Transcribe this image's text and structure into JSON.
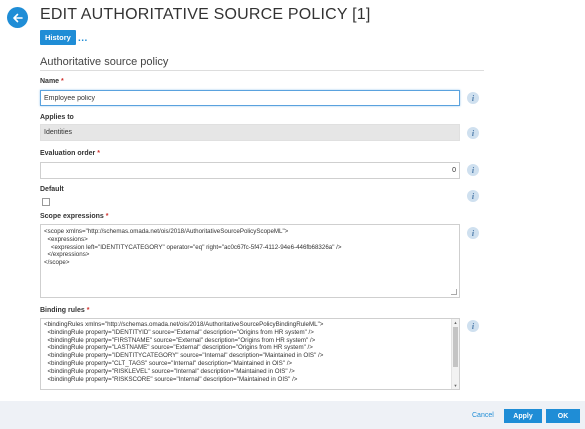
{
  "header": {
    "title": "EDIT AUTHORITATIVE SOURCE POLICY [1]",
    "history_label": "History",
    "more_label": "..."
  },
  "section": {
    "title": "Authoritative source policy"
  },
  "fields": {
    "name": {
      "label": "Name",
      "required": "*",
      "value": "Employee policy"
    },
    "applies_to": {
      "label": "Applies to",
      "value": "Identities"
    },
    "evaluation_order": {
      "label": "Evaluation order",
      "required": "*",
      "value": "0"
    },
    "default": {
      "label": "Default"
    },
    "scope_expressions": {
      "label": "Scope expressions",
      "required": "*",
      "value": "<scope xmlns=\"http://schemas.omada.net/ois/2018/AuthoritativeSourcePolicyScopeML\">\n  <expressions>\n    <expression left=\"IDENTITYCATEGORY\" operator=\"eq\" right=\"ac0c67fc-5f47-4112-94e6-446fb68326a\" />\n  </expressions>\n</scope>"
    },
    "binding_rules": {
      "label": "Binding rules",
      "required": "*",
      "value": "<bindingRules xmlns=\"http://schemas.omada.net/ois/2018/AuthoritativeSourcePolicyBindingRuleML\">\n  <bindingRule property=\"IDENTITYID\" source=\"External\" description=\"Origins from HR system\" />\n  <bindingRule property=\"FIRSTNAME\" source=\"External\" description=\"Origins from HR system\" />\n  <bindingRule property=\"LASTNAME\" source=\"External\" description=\"Origins from HR system\" />\n  <bindingRule property=\"IDENTITYCATEGORY\" source=\"Internal\" description=\"Maintained in OIS\" />\n  <bindingRule property=\"CLT_TAGS\" source=\"Internal\" description=\"Maintained in OIS\" />\n  <bindingRule property=\"RISKLEVEL\" source=\"Internal\" description=\"Maintained in OIS\" />\n  <bindingRule property=\"RISKSCORE\" source=\"Internal\" description=\"Maintained in OIS\" />"
    }
  },
  "footer": {
    "cancel_label": "Cancel",
    "apply_label": "Apply",
    "ok_label": "OK"
  },
  "icons": {
    "back": "arrow-left-icon",
    "info": "info-icon"
  },
  "colors": {
    "accent": "#1f8dd6",
    "required": "#d0312d",
    "readonly_bg": "#e6e6e6",
    "footer_bg": "#eef1f6"
  }
}
